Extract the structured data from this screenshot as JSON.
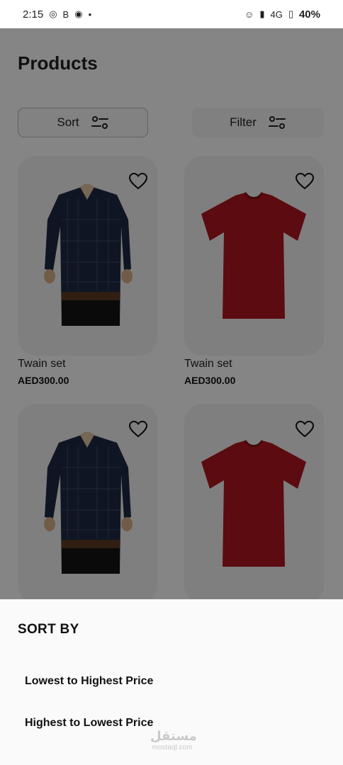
{
  "status_bar": {
    "time": "2:15",
    "network": "4G",
    "battery": "40%"
  },
  "page": {
    "title": "Products"
  },
  "controls": {
    "sort_label": "Sort",
    "filter_label": "Filter"
  },
  "products": [
    {
      "name": "Twain set",
      "price": "AED300.00",
      "image": "navy-check-shirt"
    },
    {
      "name": "Twain set",
      "price": "AED300.00",
      "image": "red-tshirt"
    },
    {
      "name": "",
      "price": "",
      "image": "navy-check-shirt"
    },
    {
      "name": "",
      "price": "",
      "image": "red-tshirt"
    }
  ],
  "sort_sheet": {
    "title": "SORT BY",
    "options": [
      "Lowest to Highest Price",
      "Highest to Lowest Price"
    ]
  },
  "watermark": {
    "arabic": "مستقل",
    "latin": "mostaql.com"
  },
  "colors": {
    "scrim": "#000000",
    "shirt_navy": "#1f2a44",
    "tshirt_red": "#b01620"
  }
}
